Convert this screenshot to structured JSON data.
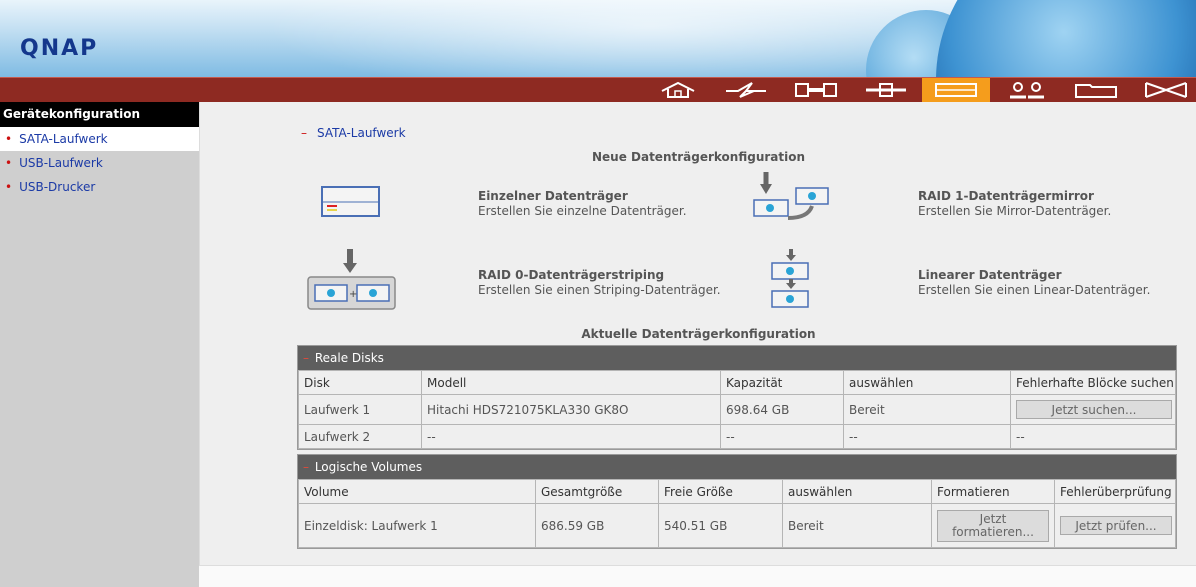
{
  "brand": {
    "logo": "QNAP"
  },
  "navbar": {
    "items": [
      {
        "name": "home-icon"
      },
      {
        "name": "power-icon"
      },
      {
        "name": "network-icon"
      },
      {
        "name": "system-tools-icon"
      },
      {
        "name": "disk-icon",
        "active": true
      },
      {
        "name": "users-icon"
      },
      {
        "name": "folder-icon"
      },
      {
        "name": "services-icon"
      }
    ]
  },
  "sidebar": {
    "title": "Gerätekonfiguration",
    "items": [
      {
        "label": "SATA-Laufwerk",
        "selected": true
      },
      {
        "label": "USB-Laufwerk"
      },
      {
        "label": "USB-Drucker"
      }
    ]
  },
  "main": {
    "section": "SATA-Laufwerk",
    "new_config_title": "Neue Datenträgerkonfiguration",
    "options": [
      {
        "title": "Einzelner Datenträger",
        "desc": "Erstellen Sie einzelne Datenträger.",
        "icon": "single-disk-icon"
      },
      {
        "title": "RAID 1-Datenträgermirror",
        "desc": "Erstellen Sie Mirror-Datenträger.",
        "icon": "raid1-icon"
      },
      {
        "title": "RAID 0-Datenträgerstriping",
        "desc": "Erstellen Sie einen Striping-Datenträger.",
        "icon": "raid0-icon"
      },
      {
        "title": "Linearer Datenträger",
        "desc": "Erstellen Sie einen Linear-Datenträger.",
        "icon": "linear-disk-icon"
      }
    ],
    "current_config_title": "Aktuelle Datenträgerkonfiguration",
    "real_disks": {
      "title": "Reale Disks",
      "columns": [
        "Disk",
        "Modell",
        "Kapazität",
        "auswählen",
        "Fehlerhafte Blöcke suchen"
      ],
      "rows": [
        {
          "disk": "Laufwerk 1",
          "model": "Hitachi HDS721075KLA330 GK8O",
          "capacity": "698.64 GB",
          "status": "Bereit",
          "action": "Jetzt suchen..."
        },
        {
          "disk": "Laufwerk 2",
          "model": "--",
          "capacity": "--",
          "status": "--",
          "action": "--"
        }
      ]
    },
    "logical_volumes": {
      "title": "Logische Volumes",
      "columns": [
        "Volume",
        "Gesamtgröße",
        "Freie Größe",
        "auswählen",
        "Formatieren",
        "Fehlerüberprüfung"
      ],
      "rows": [
        {
          "volume": "Einzeldisk: Laufwerk 1",
          "total": "686.59 GB",
          "free": "540.51 GB",
          "status": "Bereit",
          "format": "Jetzt formatieren...",
          "check": "Jetzt prüfen..."
        }
      ]
    }
  }
}
